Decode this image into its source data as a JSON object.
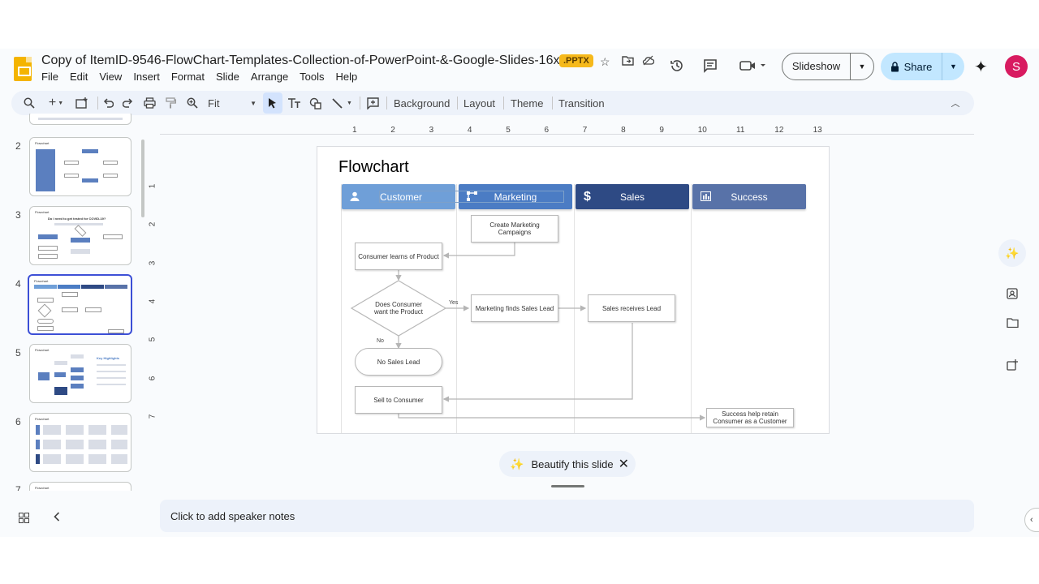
{
  "header": {
    "doc_title": "Copy of ItemID-9546-FlowChart-Templates-Collection-of-PowerPoint-&-Google-Slides-16x9",
    "file_badge": ".PPTX",
    "menu": [
      "File",
      "Edit",
      "View",
      "Insert",
      "Format",
      "Slide",
      "Arrange",
      "Tools",
      "Help"
    ],
    "slideshow_label": "Slideshow",
    "share_label": "Share",
    "avatar_letter": "S"
  },
  "toolbar": {
    "zoom_label": "Fit",
    "background_label": "Background",
    "layout_label": "Layout",
    "theme_label": "Theme",
    "transition_label": "Transition"
  },
  "ruler": {
    "h_ticks": [
      "1",
      "2",
      "3",
      "4",
      "5",
      "6",
      "7",
      "8",
      "9",
      "10",
      "11",
      "12",
      "13"
    ],
    "v_ticks": [
      "1",
      "2",
      "3",
      "4",
      "5",
      "6",
      "7"
    ]
  },
  "filmstrip": {
    "slides": [
      {
        "number": "2",
        "title": "Flowchart"
      },
      {
        "number": "3",
        "title": "Flowchart",
        "subtitle": "Do I need to get tested for COVID-19?"
      },
      {
        "number": "4",
        "title": "Flowchart",
        "selected": true
      },
      {
        "number": "5",
        "title": "Flowchart",
        "side_heading": "Key Highlights"
      },
      {
        "number": "6",
        "title": "Flowchart"
      },
      {
        "number": "7",
        "title": "Flowchart"
      }
    ]
  },
  "slide": {
    "title": "Flowchart",
    "lanes": [
      {
        "label": "Customer",
        "icon": "person-icon",
        "color": "#6f9fd8"
      },
      {
        "label": "Marketing",
        "icon": "network-icon",
        "color": "#4b7cc4"
      },
      {
        "label": "Sales",
        "icon": "dollar-icon",
        "color": "#2e4a84"
      },
      {
        "label": "Success",
        "icon": "bar-chart-icon",
        "color": "#5872a8"
      }
    ],
    "nodes": {
      "create_campaigns": "Create Marketing Campaigns",
      "consumer_learns": "Consumer learns of Product",
      "decision": "Does Consumer want the Product",
      "marketing_finds": "Marketing finds Sales Lead",
      "sales_receives": "Sales receives Lead",
      "no_sales_lead": "No Sales Lead",
      "sell": "Sell to Consumer",
      "success_retain": "Success help retain Consumer as a Customer"
    },
    "yes_label": "Yes",
    "no_label": "No"
  },
  "beautify_label": "Beautify this slide",
  "speaker_notes_placeholder": "Click to add speaker notes"
}
